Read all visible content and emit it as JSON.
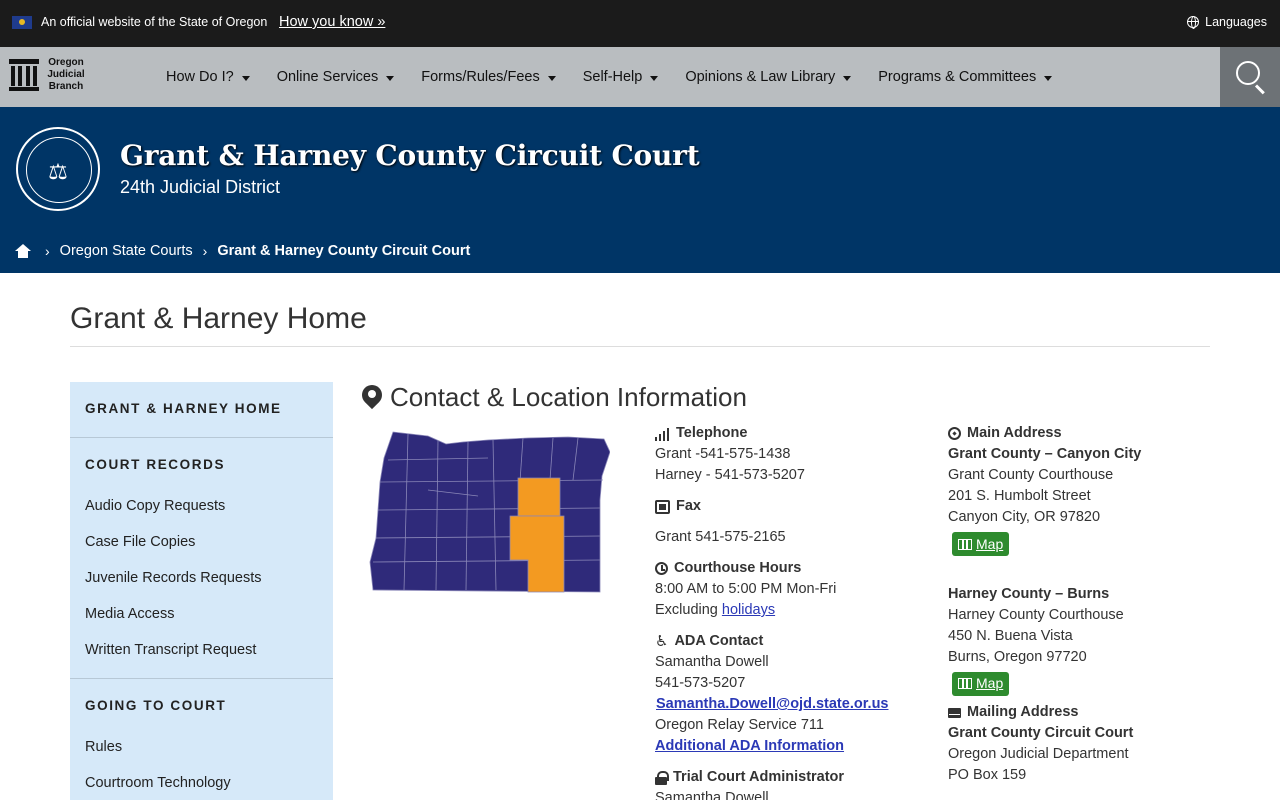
{
  "topbar": {
    "official_text": "An official website of the State of Oregon",
    "how_you_know": "How you know »",
    "languages": "Languages"
  },
  "logo": {
    "line1": "Oregon",
    "line2": "Judicial",
    "line3": "Branch"
  },
  "nav": {
    "items": [
      {
        "label": "How Do I?"
      },
      {
        "label": "Online Services"
      },
      {
        "label": "Forms/Rules/Fees"
      },
      {
        "label": "Self-Help"
      },
      {
        "label": "Opinions & Law Library"
      },
      {
        "label": "Programs & Committees"
      }
    ]
  },
  "banner": {
    "title": "Grant & Harney County Circuit Court",
    "district": "24th Judicial District",
    "breadcrumb": {
      "crumb1": "Oregon State Courts",
      "crumb2": "Grant & Harney County Circuit Court"
    }
  },
  "page": {
    "title": "Grant & Harney Home"
  },
  "sidebar": {
    "home": "GRANT & HARNEY HOME",
    "records_heading": "COURT RECORDS",
    "records": [
      "Audio Copy Requests",
      "Case File Copies",
      "Juvenile Records Requests",
      "Media Access",
      "Written Transcript Request"
    ],
    "court_heading": "GOING TO COURT",
    "court": [
      "Rules",
      "Courtroom Technology"
    ]
  },
  "contact": {
    "heading": "Contact & Location Information",
    "telephone_label": "Telephone",
    "phone_grant": "Grant -541-575-1438",
    "phone_harney": "Harney - 541-573-5207",
    "fax_label": "Fax",
    "fax_grant": "Grant 541-575-2165",
    "hours_label": "Courthouse Hours",
    "hours": "8:00 AM to 5:00 PM Mon-Fri",
    "excluding": "Excluding",
    "holidays": "holidays",
    "ada_label": "ADA Contact",
    "ada_name": "Samantha Dowell",
    "ada_phone": "541-573-5207",
    "ada_email": "Samantha.Dowell@ojd.state.or.us",
    "relay": "Oregon Relay Service 711",
    "ada_info": "Additional ADA Information",
    "tca_label": "Trial Court Administrator",
    "tca_name": "Samantha Dowell"
  },
  "address": {
    "main_label": "Main Address",
    "grant_heading": "Grant County – Canyon City",
    "grant_line1": "Grant County Courthouse",
    "grant_line2": "201 S. Humbolt Street",
    "grant_line3": "Canyon City, OR 97820",
    "map_label": "Map",
    "harney_heading": "Harney County – Burns",
    "harney_line1": "Harney County Courthouse",
    "harney_line2": "450 N. Buena Vista",
    "harney_line3": "Burns, Oregon 97720",
    "mailing_label": "Mailing Address",
    "mail_heading": "Grant County Circuit Court",
    "mail_line1": "Oregon Judicial Department",
    "mail_line2": "PO Box 159"
  },
  "colors": {
    "banner": "#003566",
    "map_base": "#2f2a7a",
    "map_highlight": "#f39a21",
    "sidebar": "#d6e9f9",
    "map_button": "#2e8b2e"
  }
}
